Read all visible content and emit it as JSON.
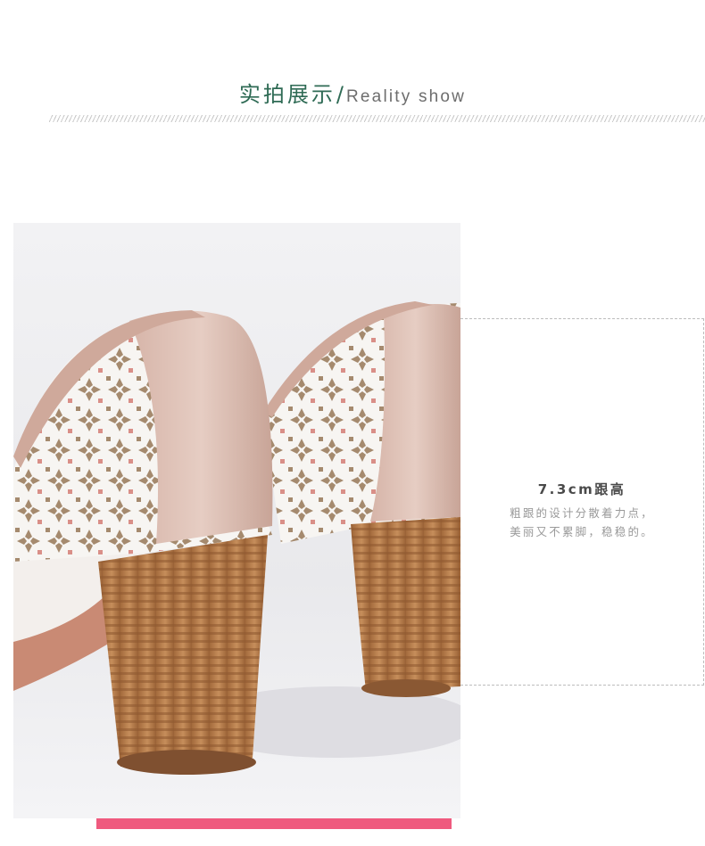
{
  "section_title": {
    "cn": "实拍展示",
    "separator": "/",
    "en": "Reality show"
  },
  "spec": {
    "title": "7.3cm跟高",
    "lines": [
      "粗跟的设计分散着力点，",
      "美丽又不累脚，稳稳的。"
    ]
  },
  "colors": {
    "title_green": "#2f6b55",
    "accent_pink": "#ef5a7e",
    "leather_pink": "#dcbfb4",
    "heel_wood": "#b07a48"
  }
}
